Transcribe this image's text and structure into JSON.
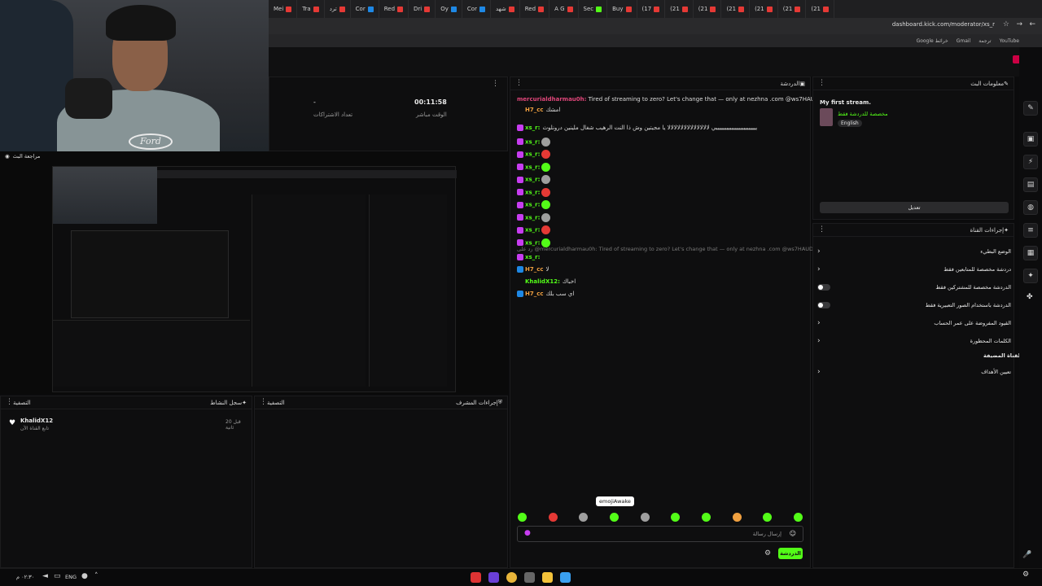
{
  "browser": {
    "tabs": [
      {
        "label": "Mei",
        "color": "#e53935"
      },
      {
        "label": "Tra",
        "color": "#e53935"
      },
      {
        "label": "ترد",
        "color": "#e53935"
      },
      {
        "label": "Cor",
        "color": "#1e88e5"
      },
      {
        "label": "Red",
        "color": "#e53935"
      },
      {
        "label": "Dri",
        "color": "#e53935"
      },
      {
        "label": "Oy",
        "color": "#1e88e5"
      },
      {
        "label": "Cor",
        "color": "#1e88e5"
      },
      {
        "label": "شهد",
        "color": "#e53935"
      },
      {
        "label": "Red",
        "color": "#e53935"
      },
      {
        "label": "A G",
        "color": "#e53935"
      },
      {
        "label": "Sec",
        "color": "#53fc18"
      },
      {
        "label": "Buy",
        "color": "#e53935"
      },
      {
        "label": "(17",
        "color": "#e53935"
      },
      {
        "label": "(21",
        "color": "#e53935"
      },
      {
        "label": "(21",
        "color": "#e53935"
      },
      {
        "label": "(21",
        "color": "#e53935"
      },
      {
        "label": "(21",
        "color": "#e53935"
      },
      {
        "label": "(21",
        "color": "#e53935"
      },
      {
        "label": "(21",
        "color": "#e53935"
      }
    ],
    "url": "dashboard.kick.com/moderator/xs_r",
    "bookmarks": [
      "Google خرائط",
      "Gmail",
      "ترجمة",
      "YouTube"
    ]
  },
  "webcam": {
    "shirt_logo": "Ford"
  },
  "stats_panel": {
    "viewers_value": "-",
    "viewers_label": "تعداد الاشتراكات",
    "uptime_value": "00:11:58",
    "uptime_label": "الوقت مباشر"
  },
  "preview_panel": {
    "title": "مراجعة البث"
  },
  "activity_panel": {
    "title": "سجل النشاط",
    "filter": "التصفية",
    "items": [
      {
        "user": "KhalidX12",
        "action": "تابع القناة الآن",
        "time": "قبل 20 ثانية"
      }
    ]
  },
  "mod_actions_panel": {
    "title": "إجراءات المشرف",
    "filter": "التصفية"
  },
  "chat": {
    "title": "الدردشة",
    "pinned_user": "mercurialdharmau0h:",
    "pinned_text": "Tired of streaming to zero? Let's change that — only at nezhna .com @ws7HAUDH",
    "messages": [
      {
        "user": "H7_cc",
        "text": "امشك",
        "kind": "orange"
      },
      {
        "user": "xs_r:",
        "text": "ييييييييييييييييييييييييي لالالالالالالالالالالالالا يا مجيتين وش ذا النت الرهيب شغال ملينين درونلوث",
        "kind": "long"
      },
      {
        "user": "xs_r:",
        "emote": "#9e9e9e"
      },
      {
        "user": "xs_r:",
        "emote": "#e53935"
      },
      {
        "user": "xs_r:",
        "emote": "#53fc18"
      },
      {
        "user": "xs_r:",
        "emote": "#9e9e9e"
      },
      {
        "user": "xs_r:",
        "emote": "#e53935"
      },
      {
        "user": "xs_r:",
        "emote": "#53fc18"
      },
      {
        "user": "xs_r:",
        "emote": "#9e9e9e"
      },
      {
        "user": "xs_r:",
        "emote": "#e53935"
      },
      {
        "user": "xs_r:",
        "emote": "#53fc18"
      }
    ],
    "deleted_line": "رد على @mercurialdharmau0h: Tired of streaming to zero? Let's change that — only at nezhna .com @ws7HAUDH",
    "after": [
      {
        "user": "xs_r:",
        "text": ""
      },
      {
        "user": "H7_cc",
        "text": "لا"
      },
      {
        "user": "KhalidX12:",
        "text": "اخباك"
      },
      {
        "user": "H7_cc",
        "text": "اي سب بلك"
      }
    ],
    "tooltip": "emojiAwake",
    "input_placeholder": "إرسال رسالة",
    "send_button": "الدردشة"
  },
  "stream_info": {
    "title": "معلومات البث",
    "stream_title": "My first stream.",
    "category": "مخصصة للدردشة فقط",
    "language": "English",
    "edit_button": "تعديل"
  },
  "channel_actions": {
    "title": "إجراءات القناة",
    "items": [
      {
        "label": "الوضع البطيء",
        "control": "chevron"
      },
      {
        "label": "دردشة مخصصة للمتابعين فقط",
        "control": "chevron"
      },
      {
        "label": "الدردشة مخصصة للمشتركين فقط",
        "control": "toggle"
      },
      {
        "label": "الدردشة باستخدام الصور التعبيرية فقط",
        "control": "toggle"
      },
      {
        "label": "القيود المفروضة على عمر الحساب",
        "control": "chevron"
      },
      {
        "label": "الكلمات المحظورة",
        "control": "chevron"
      }
    ],
    "section_label": "القناة المضيفة",
    "host_item": "تعيين الأهداف"
  },
  "taskbar": {
    "lang": "ENG",
    "clock": "٠٢:٣٠ م"
  },
  "colors": {
    "kick_green": "#53fc18",
    "panel_bg": "#0e0e0f",
    "username_pink": "#e0467a"
  }
}
